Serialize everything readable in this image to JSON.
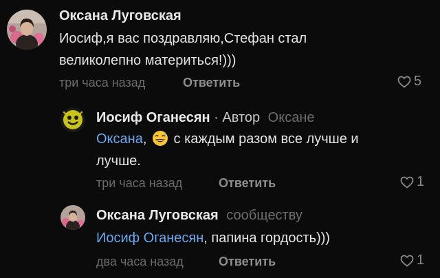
{
  "comments": [
    {
      "author": "Оксана Луговская",
      "text_line1": "Иосиф,я вас поздравляю,Стефан стал",
      "text_line2": "великолепно материться!)))",
      "time": "три часа назад",
      "reply_label": "Ответить",
      "likes": "5"
    },
    {
      "author": "Иосиф Оганесян",
      "author_badge": " · Автор",
      "addressee": "Оксане",
      "mention": "Оксана",
      "text_after_mention": " с каждым разом все лучше и",
      "text_line2": "лучше.",
      "emoji": "grinning-sweat-emoji",
      "time": "три часа назад",
      "reply_label": "Ответить",
      "likes": "1"
    },
    {
      "author": "Оксана Луговская",
      "addressee": "сообществу",
      "mention": "Иосиф Оганесян",
      "text_after_mention": ", папина гордость)))",
      "time": "два часа назад",
      "reply_label": "Ответить",
      "likes": "1"
    }
  ],
  "colors": {
    "background": "#0b0b0b",
    "mention": "#6aa6f0",
    "muted": "#6b6b6b"
  },
  "icons": {
    "like": "heart-outline-icon"
  }
}
